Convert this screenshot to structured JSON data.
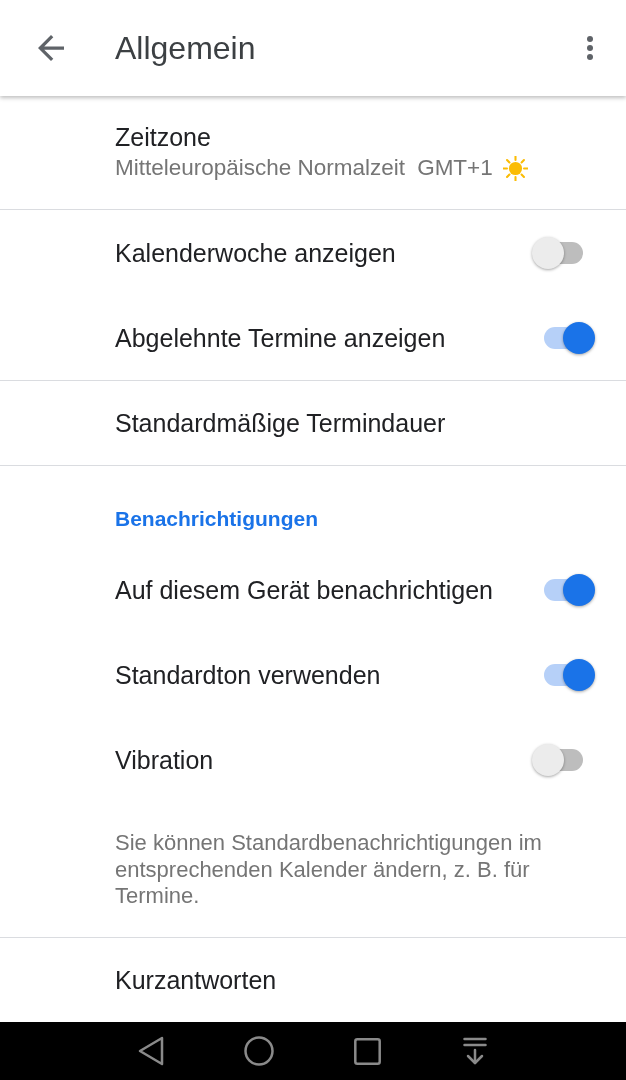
{
  "app_bar": {
    "title": "Allgemein"
  },
  "groups": [
    {
      "items": [
        {
          "kind": "timezone",
          "title": "Zeitzone",
          "subtitle": "Mitteleuropäische Normalzeit",
          "offset": "GMT+1"
        }
      ]
    },
    {
      "items": [
        {
          "kind": "toggle",
          "label": "Kalenderwoche anzeigen",
          "on": false
        },
        {
          "kind": "toggle",
          "label": "Abgelehnte Termine anzeigen",
          "on": true
        }
      ]
    },
    {
      "items": [
        {
          "kind": "link",
          "label": "Standardmäßige Termindauer"
        }
      ]
    },
    {
      "items": [
        {
          "kind": "header",
          "label": "Benachrichtigungen"
        },
        {
          "kind": "toggle",
          "label": "Auf diesem Gerät benachrichtigen",
          "on": true
        },
        {
          "kind": "toggle",
          "label": "Standardton verwenden",
          "on": true
        },
        {
          "kind": "toggle",
          "label": "Vibration",
          "on": false
        },
        {
          "kind": "note",
          "text": "Sie können Standardbenachrichtigungen im entsprechenden Kalender ändern, z. B. für Termine."
        }
      ]
    },
    {
      "items": [
        {
          "kind": "link",
          "label": "Kurzantworten"
        }
      ]
    }
  ]
}
